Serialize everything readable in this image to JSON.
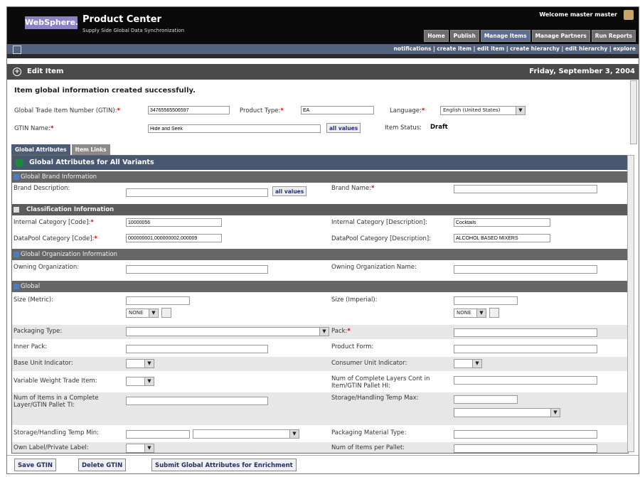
{
  "header": {
    "logo": "WebSphere.",
    "product": "Product Center",
    "subtitle": "Supply Side Global Data Synchronization",
    "welcome": "Welcome master master",
    "nav": [
      "Home",
      "Publish",
      "Manage Items",
      "Manage Partners",
      "Run Reports"
    ],
    "subnav": "notifications | create item | edit item | create hierarchy | edit hierarchy | explore"
  },
  "editbar": {
    "title": "Edit Item",
    "date": "Friday, September 3, 2004"
  },
  "message": "Item global information created successfully.",
  "top_form": {
    "gtin_label": "Global Trade Item Number (GTIN):",
    "gtin_value": "34765565506597",
    "product_type_label": "Product Type:",
    "product_type_value": "EA",
    "language_label": "Language:",
    "language_value": "English (United States)",
    "gtin_name_label": "GTIN Name:",
    "gtin_name_value": "Hide and Seek",
    "all_values": "all values",
    "item_status_label": "Item Status:",
    "item_status_value": "Draft"
  },
  "tabs": [
    "Global Attributes",
    "Item Links"
  ],
  "section_title": "Global Attributes for All Variants",
  "groups": {
    "brand": "Global Brand Information",
    "classification": "Classification Information",
    "organization": "Global Organization Information",
    "global": "Global"
  },
  "fields": {
    "brand_desc": "Brand Description:",
    "brand_name": "Brand Name:",
    "int_cat_code": "Internal Category [Code]:",
    "int_cat_code_val": "10000056",
    "int_cat_desc": "Internal Category [Description]:",
    "int_cat_desc_val": "Cocktails",
    "dp_cat_code": "DataPool Category [Code]:",
    "dp_cat_code_val": "000000001,000000002,000009",
    "dp_cat_desc": "DataPool Category [Description]:",
    "dp_cat_desc_val": "ALCOHOL BASED MIXERS",
    "owning_org": "Owning Organization:",
    "owning_org_name": "Owning Organization Name:",
    "size_metric": "Size (Metric):",
    "size_imperial": "Size (Imperial):",
    "none": "NONE",
    "packaging_type": "Packaging Type:",
    "pack": "Pack:",
    "inner_pack": "Inner Pack:",
    "product_form": "Product Form:",
    "base_unit": "Base Unit Indicator:",
    "consumer_unit": "Consumer Unit Indicator:",
    "variable_weight": "Variable Weight Trade Item:",
    "num_layers": "Num of Complete Layers Cont in Item/GTIN Pallet HI:",
    "num_items_layer": "Num of Items in a Complete Layer/GTIN Pallet TI:",
    "storage_max": "Storage/Handling Temp Max:",
    "storage_min": "Storage/Handling Temp Min:",
    "packaging_material": "Packaging Material Type:",
    "own_label": "Own Label/Private Label:",
    "items_per_pallet": "Num of Items per Pallet:"
  },
  "footer": {
    "save": "Save GTIN",
    "delete": "Delete GTIN",
    "submit": "Submit Global Attributes for Enrichment"
  }
}
